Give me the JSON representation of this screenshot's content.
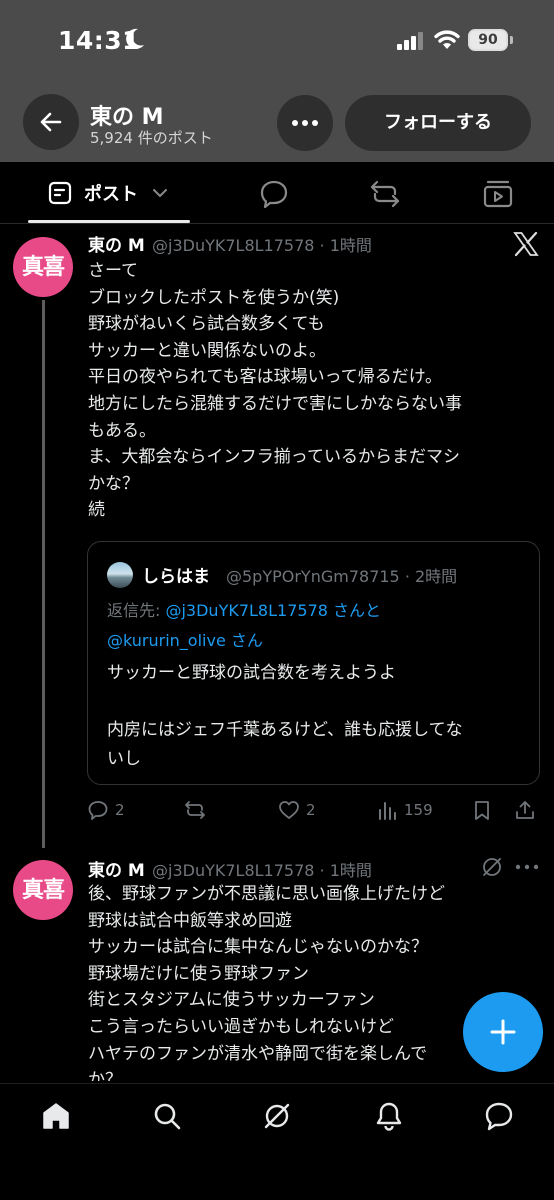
{
  "status_bar": {
    "time": "14:31",
    "battery": "90"
  },
  "header": {
    "name": "東の M",
    "post_count": "5,924 件のポスト",
    "follow_label": "フォローする"
  },
  "tabs": {
    "posts_label": "ポスト"
  },
  "posts": [
    {
      "avatar_text": "真喜",
      "name": "東の M",
      "handle": "@j3DuYK7L8L17578 · 1時間",
      "body": "さーて\nブロックしたポストを使うか(笑)\n野球がねいくら試合数多くても\nサッカーと違い関係ないのよ。\n平日の夜やられても客は球場いって帰るだけ。\n地方にしたら混雑するだけで害にしかならない事\nもある。\nま、大都会ならインフラ揃っているからまだマシ\nかな？\n続",
      "quote": {
        "name": "しらはま",
        "handle": "@5pYPOrYnGm78715 · 2時間",
        "reply_prefix": "返信先: ",
        "mention1": "@j3DuYK7L8L17578 さんと",
        "mention2": "@kururin_olive さん",
        "body": "サッカーと野球の試合数を考えようよ\n\n内房にはジェフ千葉あるけど、誰も応援してな\nいし"
      },
      "replies": "2",
      "likes": "2",
      "views": "159"
    },
    {
      "avatar_text": "真喜",
      "name": "東の M",
      "handle": "@j3DuYK7L8L17578 · 1時間",
      "body": "後、野球ファンが不思議に思い画像上げたけど\n野球は試合中飯等求め回遊\nサッカーは試合に集中なんじゃないのかな？\n野球場だけに使う野球ファン\n街とスタジアムに使うサッカーファン\nこう言ったらいい過ぎかもしれないけど\nハヤテのファンが清水や静岡で街を楽しんで\nか？"
    }
  ],
  "colors": {
    "accent": "#1d9bf0",
    "avatar": "#e84a88"
  }
}
